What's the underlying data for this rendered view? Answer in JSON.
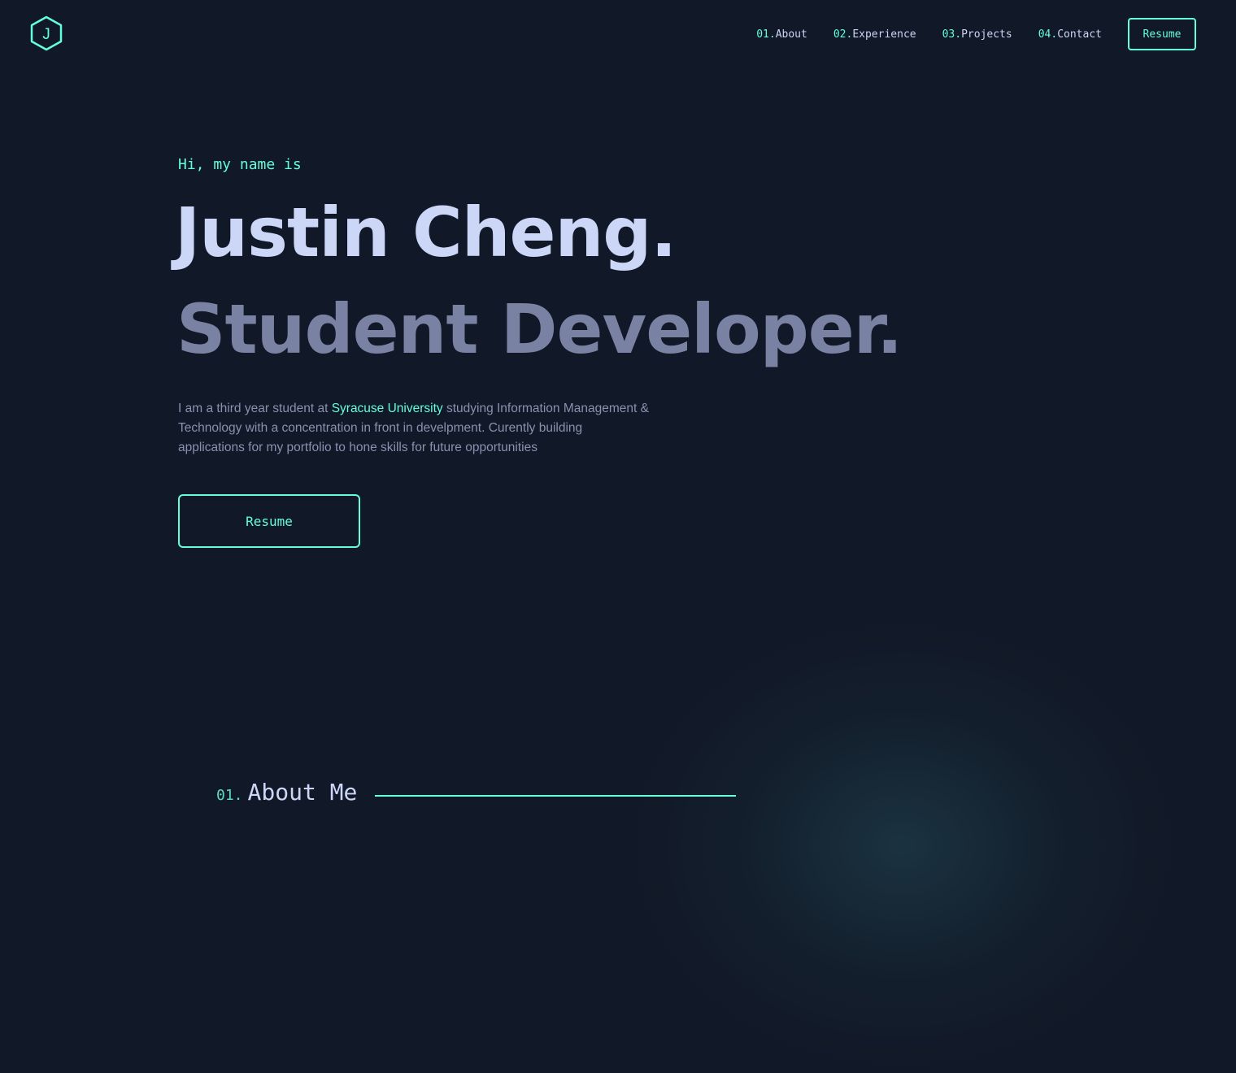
{
  "nav": {
    "logo_letter": "J",
    "items": [
      {
        "num": "01.",
        "label": "About"
      },
      {
        "num": "02.",
        "label": "Experience"
      },
      {
        "num": "03.",
        "label": "Projects"
      },
      {
        "num": "04.",
        "label": "Contact"
      }
    ],
    "resume_label": "Resume"
  },
  "hero": {
    "greeting": "Hi, my name is",
    "name": "Justin Cheng.",
    "role": "Student Developer.",
    "description": {
      "before": "I am a third year student at ",
      "highlight": "Syracuse University",
      "after": " studying Information Management & Technology with a concentration in front in develpment. Curently building applications for my portfolio to hone skills for future opportunities"
    },
    "resume_label": "Resume"
  },
  "about": {
    "num": "01.",
    "title": "About Me"
  },
  "colors": {
    "background": "#111827",
    "accent": "#64ffda",
    "heading": "#ccd6f6",
    "subheading": "#7a82a3",
    "body_text": "#8892b0"
  },
  "icons": {
    "logo": "hexagon-logo-icon"
  }
}
